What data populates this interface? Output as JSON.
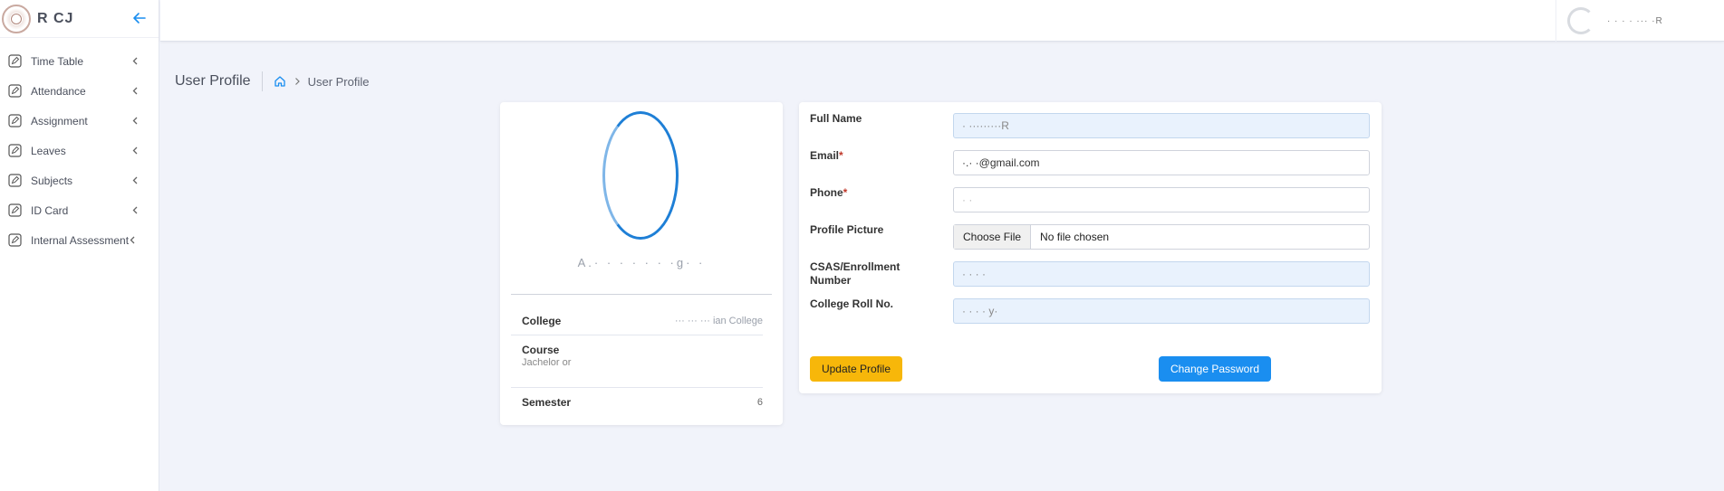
{
  "brand": {
    "name": "R  CJ"
  },
  "sidebar": {
    "items": [
      {
        "label": "Time Table"
      },
      {
        "label": "Attendance"
      },
      {
        "label": "Assignment"
      },
      {
        "label": "Leaves"
      },
      {
        "label": "Subjects"
      },
      {
        "label": "ID Card"
      },
      {
        "label": "Internal Assessment"
      }
    ]
  },
  "topbar": {
    "user_name": "·  ·  · ·      ···  ·R"
  },
  "header": {
    "title": "User Profile",
    "breadcrumb_current": "User Profile"
  },
  "profile": {
    "name": "A.·  ·    · ·  · ·  ·g·  ·",
    "rows": [
      {
        "key": "College",
        "value": "···  ··· ··· ian College"
      },
      {
        "key": "Course",
        "value": "Jachelor or"
      },
      {
        "key": "Semester",
        "value": "6"
      }
    ]
  },
  "form": {
    "full_name_label": "Full Name",
    "full_name_value": "·              ·········R",
    "email_label": "Email",
    "email_value": "·.·            ·@gmail.com",
    "phone_label": "Phone",
    "phone_value": "·                      ·",
    "picture_label": "Profile Picture",
    "choose_file": "Choose File",
    "no_file": "No file chosen",
    "csas_label_line1": "CSAS/Enrollment",
    "csas_label_line2": "Number",
    "csas_value": "· ·  ·                           ·",
    "roll_label": "College Roll No.",
    "roll_value": "·   ·   ·  ·  y·",
    "required_mark": "*",
    "update_button": "Update Profile",
    "password_button": "Change Password"
  },
  "colors": {
    "accent": "#1a8ef0",
    "warning": "#f7b70a",
    "background": "#f1f3fa"
  }
}
